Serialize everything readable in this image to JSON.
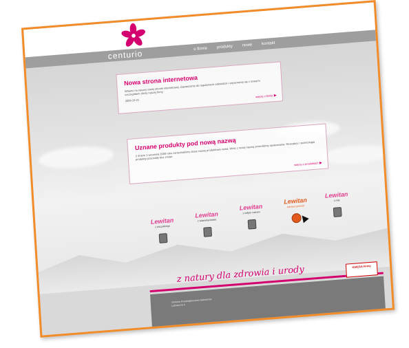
{
  "site": {
    "brand": "centurio",
    "nav": [
      "o firmie",
      "produkty",
      "nowe",
      "kontakt"
    ]
  },
  "news": {
    "title": "Nowa strona internetowa",
    "body": "Witamy na naszej nowej stronie internetowej. Zapraszamy do regularnych odwiedzin i zapoznania się z nowymi szczegółami oferty naszej firmy.",
    "date": "2008-10-21",
    "more": "więcej o firmie"
  },
  "products_news": {
    "title": "Uznane produkty pod nową nazwą",
    "body": "Z dniem 1 września 2008 roku zaniechaliśmy stara nazwę produktowa nowa. Wraz z nową nazwą zmieniliśmy opakowania. Receptury i technologia produkcji pozostały bez zmian.",
    "more": "więcej o produktach"
  },
  "products": [
    {
      "logo": "Lewitan",
      "sub": "z wszystkiego",
      "highlight": false
    },
    {
      "logo": "Lewitan",
      "sub": "z witaminą kwasu",
      "highlight": false
    },
    {
      "logo": "Lewitan",
      "sub": "z żółtym cukrem",
      "highlight": false
    },
    {
      "logo": "Lewitan",
      "sub": "zdrowa żywność",
      "highlight": true
    },
    {
      "logo": "Lewitan",
      "sub": "z miły",
      "highlight": false
    }
  ],
  "tagline": "z natury dla zdrowia i urody",
  "footer": {
    "lines": [
      "Centurio Przedsiębiorstwo Wytwórcze",
      "Lubnica Nr 4"
    ],
    "badge": "KSIĘGA Firmy"
  },
  "colors": {
    "accent": "#d4006f",
    "frame": "#f28c28",
    "highlight": "#e3591b"
  }
}
